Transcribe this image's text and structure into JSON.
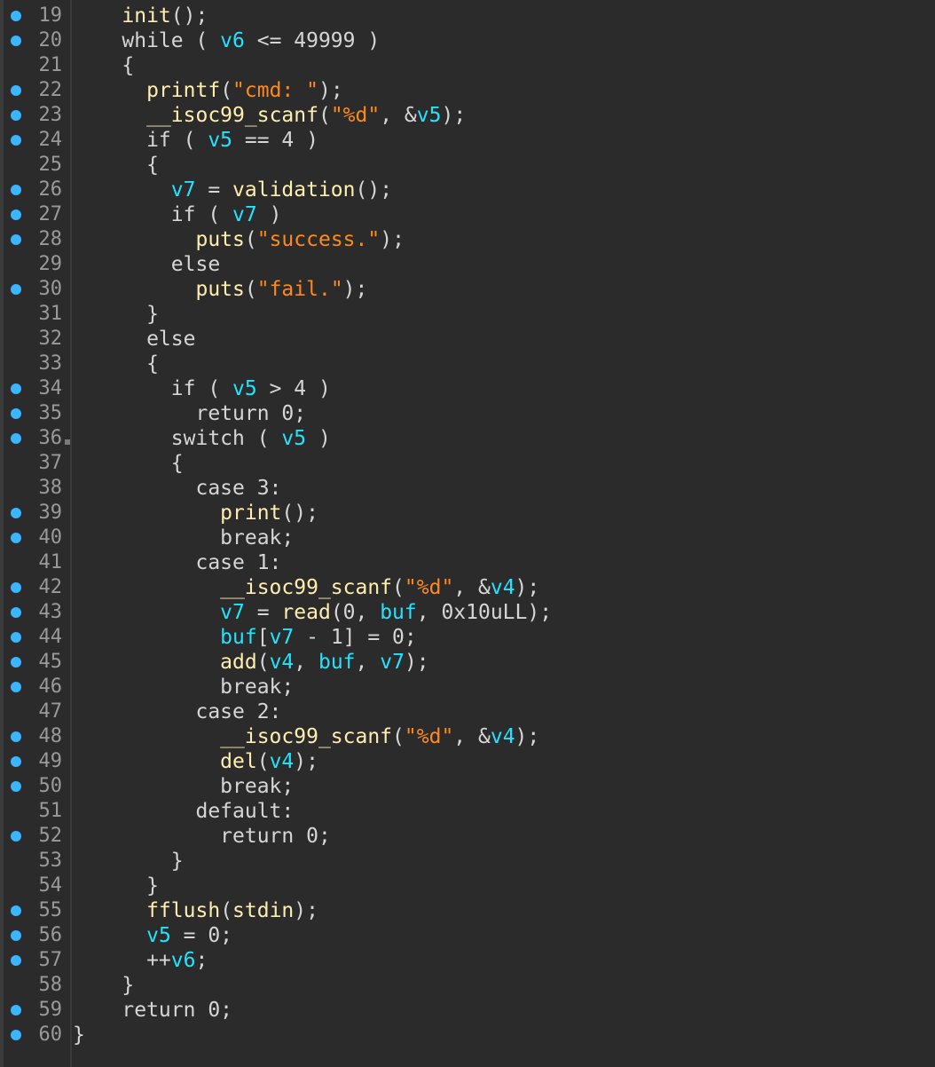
{
  "editor": {
    "lines": [
      {
        "num": "19",
        "bp": true,
        "tokens": [
          [
            "    ",
            "p"
          ],
          [
            "init",
            "f"
          ],
          [
            "();",
            "p"
          ]
        ]
      },
      {
        "num": "20",
        "bp": true,
        "tokens": [
          [
            "    while ( ",
            "p"
          ],
          [
            "v6",
            "v"
          ],
          [
            " <= 49999 )",
            "p"
          ]
        ]
      },
      {
        "num": "21",
        "bp": false,
        "tokens": [
          [
            "    {",
            "p"
          ]
        ]
      },
      {
        "num": "22",
        "bp": true,
        "tokens": [
          [
            "      ",
            "p"
          ],
          [
            "printf",
            "f"
          ],
          [
            "(",
            "p"
          ],
          [
            "\"cmd: \"",
            "s"
          ],
          [
            ");",
            "p"
          ]
        ]
      },
      {
        "num": "23",
        "bp": true,
        "tokens": [
          [
            "      ",
            "p"
          ],
          [
            "__isoc99_scanf",
            "f"
          ],
          [
            "(",
            "p"
          ],
          [
            "\"%d\"",
            "s"
          ],
          [
            ", &",
            "p"
          ],
          [
            "v5",
            "v"
          ],
          [
            ");",
            "p"
          ]
        ]
      },
      {
        "num": "24",
        "bp": true,
        "tokens": [
          [
            "      if ( ",
            "p"
          ],
          [
            "v5",
            "v"
          ],
          [
            " == 4 )",
            "p"
          ]
        ]
      },
      {
        "num": "25",
        "bp": false,
        "tokens": [
          [
            "      {",
            "p"
          ]
        ]
      },
      {
        "num": "26",
        "bp": true,
        "tokens": [
          [
            "        ",
            "p"
          ],
          [
            "v7",
            "v"
          ],
          [
            " = ",
            "p"
          ],
          [
            "validation",
            "f"
          ],
          [
            "();",
            "p"
          ]
        ]
      },
      {
        "num": "27",
        "bp": true,
        "tokens": [
          [
            "        if ( ",
            "p"
          ],
          [
            "v7",
            "v"
          ],
          [
            " )",
            "p"
          ]
        ]
      },
      {
        "num": "28",
        "bp": true,
        "tokens": [
          [
            "          ",
            "p"
          ],
          [
            "puts",
            "f"
          ],
          [
            "(",
            "p"
          ],
          [
            "\"success.\"",
            "s"
          ],
          [
            ");",
            "p"
          ]
        ]
      },
      {
        "num": "29",
        "bp": false,
        "tokens": [
          [
            "        else",
            "p"
          ]
        ]
      },
      {
        "num": "30",
        "bp": true,
        "tokens": [
          [
            "          ",
            "p"
          ],
          [
            "puts",
            "f"
          ],
          [
            "(",
            "p"
          ],
          [
            "\"fail.\"",
            "s"
          ],
          [
            ");",
            "p"
          ]
        ]
      },
      {
        "num": "31",
        "bp": false,
        "tokens": [
          [
            "      }",
            "p"
          ]
        ]
      },
      {
        "num": "32",
        "bp": false,
        "tokens": [
          [
            "      else",
            "p"
          ]
        ]
      },
      {
        "num": "33",
        "bp": false,
        "tokens": [
          [
            "      {",
            "p"
          ]
        ]
      },
      {
        "num": "34",
        "bp": true,
        "tokens": [
          [
            "        if ( ",
            "p"
          ],
          [
            "v5",
            "v"
          ],
          [
            " > 4 )",
            "p"
          ]
        ]
      },
      {
        "num": "35",
        "bp": true,
        "tokens": [
          [
            "          return 0;",
            "p"
          ]
        ]
      },
      {
        "num": "36",
        "bp": true,
        "marker": true,
        "tokens": [
          [
            "        switch ( ",
            "p"
          ],
          [
            "v5",
            "v"
          ],
          [
            " )",
            "p"
          ]
        ]
      },
      {
        "num": "37",
        "bp": false,
        "tokens": [
          [
            "        {",
            "p"
          ]
        ]
      },
      {
        "num": "38",
        "bp": false,
        "tokens": [
          [
            "          case 3:",
            "p"
          ]
        ]
      },
      {
        "num": "39",
        "bp": true,
        "tokens": [
          [
            "            ",
            "p"
          ],
          [
            "print",
            "f"
          ],
          [
            "();",
            "p"
          ]
        ]
      },
      {
        "num": "40",
        "bp": true,
        "tokens": [
          [
            "            break;",
            "p"
          ]
        ]
      },
      {
        "num": "41",
        "bp": false,
        "tokens": [
          [
            "          case 1:",
            "p"
          ]
        ]
      },
      {
        "num": "42",
        "bp": true,
        "tokens": [
          [
            "            ",
            "p"
          ],
          [
            "__isoc99_scanf",
            "f"
          ],
          [
            "(",
            "p"
          ],
          [
            "\"%d\"",
            "s"
          ],
          [
            ", &",
            "p"
          ],
          [
            "v4",
            "v"
          ],
          [
            ");",
            "p"
          ]
        ]
      },
      {
        "num": "43",
        "bp": true,
        "tokens": [
          [
            "            ",
            "p"
          ],
          [
            "v7",
            "v"
          ],
          [
            " = ",
            "p"
          ],
          [
            "read",
            "f"
          ],
          [
            "(0, ",
            "p"
          ],
          [
            "buf",
            "v"
          ],
          [
            ", 0x10uLL);",
            "p"
          ]
        ]
      },
      {
        "num": "44",
        "bp": true,
        "tokens": [
          [
            "            ",
            "p"
          ],
          [
            "buf",
            "v"
          ],
          [
            "[",
            "p"
          ],
          [
            "v7",
            "v"
          ],
          [
            " - 1] = 0;",
            "p"
          ]
        ]
      },
      {
        "num": "45",
        "bp": true,
        "tokens": [
          [
            "            ",
            "p"
          ],
          [
            "add",
            "f"
          ],
          [
            "(",
            "p"
          ],
          [
            "v4",
            "v"
          ],
          [
            ", ",
            "p"
          ],
          [
            "buf",
            "v"
          ],
          [
            ", ",
            "p"
          ],
          [
            "v7",
            "v"
          ],
          [
            ");",
            "p"
          ]
        ]
      },
      {
        "num": "46",
        "bp": true,
        "tokens": [
          [
            "            break;",
            "p"
          ]
        ]
      },
      {
        "num": "47",
        "bp": false,
        "tokens": [
          [
            "          case 2:",
            "p"
          ]
        ]
      },
      {
        "num": "48",
        "bp": true,
        "tokens": [
          [
            "            ",
            "p"
          ],
          [
            "__isoc99_scanf",
            "f"
          ],
          [
            "(",
            "p"
          ],
          [
            "\"%d\"",
            "s"
          ],
          [
            ", &",
            "p"
          ],
          [
            "v4",
            "v"
          ],
          [
            ");",
            "p"
          ]
        ]
      },
      {
        "num": "49",
        "bp": true,
        "tokens": [
          [
            "            ",
            "p"
          ],
          [
            "del",
            "f"
          ],
          [
            "(",
            "p"
          ],
          [
            "v4",
            "v"
          ],
          [
            ");",
            "p"
          ]
        ]
      },
      {
        "num": "50",
        "bp": true,
        "tokens": [
          [
            "            break;",
            "p"
          ]
        ]
      },
      {
        "num": "51",
        "bp": false,
        "tokens": [
          [
            "          default:",
            "p"
          ]
        ]
      },
      {
        "num": "52",
        "bp": true,
        "tokens": [
          [
            "            return 0;",
            "p"
          ]
        ]
      },
      {
        "num": "53",
        "bp": false,
        "tokens": [
          [
            "        }",
            "p"
          ]
        ]
      },
      {
        "num": "54",
        "bp": false,
        "tokens": [
          [
            "      }",
            "p"
          ]
        ]
      },
      {
        "num": "55",
        "bp": true,
        "tokens": [
          [
            "      ",
            "p"
          ],
          [
            "fflush",
            "f"
          ],
          [
            "(",
            "p"
          ],
          [
            "stdin",
            "f"
          ],
          [
            ");",
            "p"
          ]
        ]
      },
      {
        "num": "56",
        "bp": true,
        "tokens": [
          [
            "      ",
            "p"
          ],
          [
            "v5",
            "v"
          ],
          [
            " = 0;",
            "p"
          ]
        ]
      },
      {
        "num": "57",
        "bp": true,
        "tokens": [
          [
            "      ++",
            "p"
          ],
          [
            "v6",
            "v"
          ],
          [
            ";",
            "p"
          ]
        ]
      },
      {
        "num": "58",
        "bp": false,
        "tokens": [
          [
            "    }",
            "p"
          ]
        ]
      },
      {
        "num": "59",
        "bp": true,
        "tokens": [
          [
            "    return 0;",
            "p"
          ]
        ]
      },
      {
        "num": "60",
        "bp": true,
        "tokens": [
          [
            "}",
            "p"
          ]
        ]
      }
    ]
  },
  "colors": {
    "background": "#2b2b2b",
    "gutter_number": "#9a9a9a",
    "breakpoint_dot": "#3ab6ff",
    "function": "#ffeeb0",
    "variable": "#24e3ff",
    "string": "#ff8a1c",
    "plain": "#d6d6d6"
  }
}
